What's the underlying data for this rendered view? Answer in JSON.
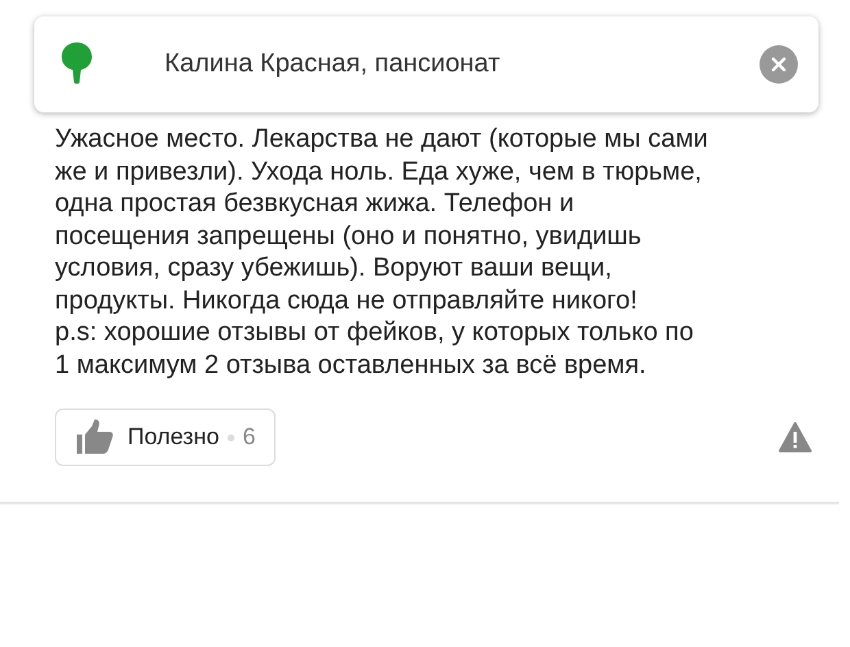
{
  "place": {
    "name": "Калина Красная, пансионат"
  },
  "review": {
    "paragraphs": [
      "Ужасное место. Лекарства не дают (которые мы сами же и привезли). Ухода ноль. Еда хуже, чем в тюрьме, одна простая безвкусная жижа. Телефон и посещения запрещены (оно и понятно, увидишь условия, сразу убежишь). Воруют ваши вещи, продукты. Никогда сюда не отправляйте никого!",
      "p.s: хорошие отзывы от фейков, у которых только по 1 максимум 2 отзыва оставленных за всё время."
    ]
  },
  "useful": {
    "label": "Полезно",
    "count": "6"
  }
}
